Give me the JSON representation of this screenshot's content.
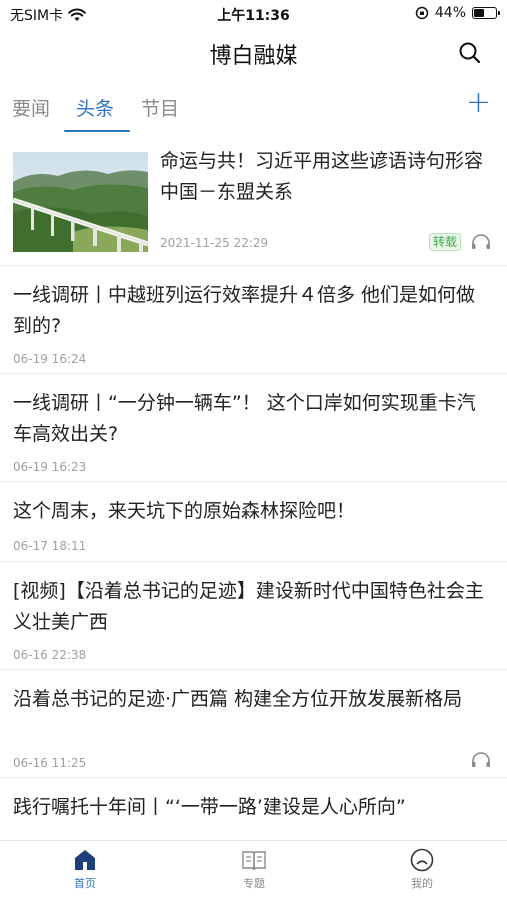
{
  "status_bar": {
    "carrier": "无SIM卡",
    "time": "上午11:36",
    "battery": "44%",
    "battery_level": 0.44
  },
  "header": {
    "title": "博白融媒",
    "search_icon": "search-icon"
  },
  "tabs": [
    {
      "label": "要闻",
      "active": false
    },
    {
      "label": "头条",
      "active": true
    },
    {
      "label": "节目",
      "active": false
    }
  ],
  "tab_add_label": "+",
  "accent_color": "#2f74c4",
  "featured": {
    "title": "命运与共！习近平用这些谚语诗句形容中国－东盟关系",
    "time": "2021-11-25 22:29",
    "badge": "转载",
    "image": "railway-viaduct-landscape"
  },
  "articles": [
    {
      "title": "一线调研丨中越班列运行效率提升４倍多 他们是如何做到的?",
      "time": "06-19 16:24"
    },
    {
      "title": "一线调研丨“一分钟一辆车”！ 这个口岸如何实现重卡汽车高效出关?",
      "time": "06-19 16:23"
    },
    {
      "title": "这个周末，来天坑下的原始森林探险吧！",
      "time": "06-17 18:11"
    },
    {
      "title": "[视频]【沿着总书记的足迹】建设新时代中国特色社会主义壮美广西",
      "time": "06-16 22:38"
    },
    {
      "title": "沿着总书记的足迹·广西篇 构建全方位开放发展新格局",
      "time": "06-16 11:25"
    },
    {
      "title": "践行嘱托十年间丨“‘一带一路’建设是人心所向”",
      "time": ""
    }
  ],
  "bottom_nav": [
    {
      "label": "首页",
      "icon": "home-icon",
      "active": true
    },
    {
      "label": "专题",
      "icon": "book-icon",
      "active": false
    },
    {
      "label": "我的",
      "icon": "profile-icon",
      "active": false
    }
  ]
}
